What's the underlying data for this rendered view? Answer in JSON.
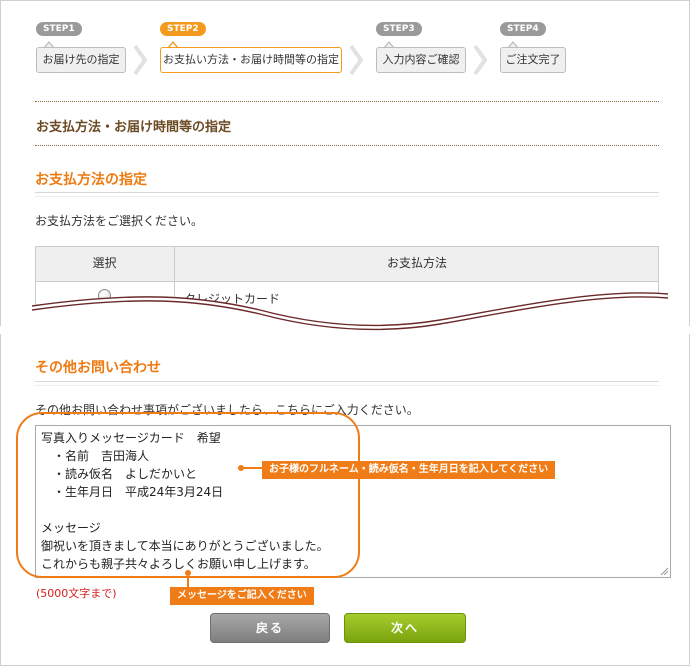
{
  "steps": [
    {
      "tag": "STEP1",
      "label": "お届け先の指定"
    },
    {
      "tag": "STEP2",
      "label": "お支払い方法・お届け時間等の指定"
    },
    {
      "tag": "STEP3",
      "label": "入力内容ご確認"
    },
    {
      "tag": "STEP4",
      "label": "ご注文完了"
    }
  ],
  "page_title": "お支払方法・お届け時間等の指定",
  "payment": {
    "title": "お支払方法の指定",
    "instruction": "お支払方法をご選択ください。",
    "table": {
      "headers": [
        "選択",
        "お支払方法"
      ],
      "rows": [
        {
          "method": "クレジットカード"
        }
      ]
    }
  },
  "inquiry": {
    "title": "その他お問い合わせ",
    "instruction": "その他お問い合わせ事項がございましたら、こちらにご入力ください。",
    "message": "写真入りメッセージカード　希望\n　・名前　吉田海人\n　・読み仮名　よしだかいと\n　・生年月日　平成24年3月24日\n\nメッセージ\n御祝いを頂きまして本当にありがとうございました。\nこれからも親子共々よろしくお願い申し上げます。",
    "limit": "(5000文字まで)"
  },
  "annotations": {
    "note_fullname": "お子様のフルネーム・読み仮名・生年月日を記入してください",
    "note_message": "メッセージをご記入ください"
  },
  "buttons": {
    "back": "戻る",
    "next": "次へ"
  },
  "colors": {
    "accent": "#f07c17",
    "active_step": "#f39a1e",
    "next_button": "#8db81b",
    "back_button": "#8f8f8f",
    "limit_text": "#d81e1e"
  }
}
